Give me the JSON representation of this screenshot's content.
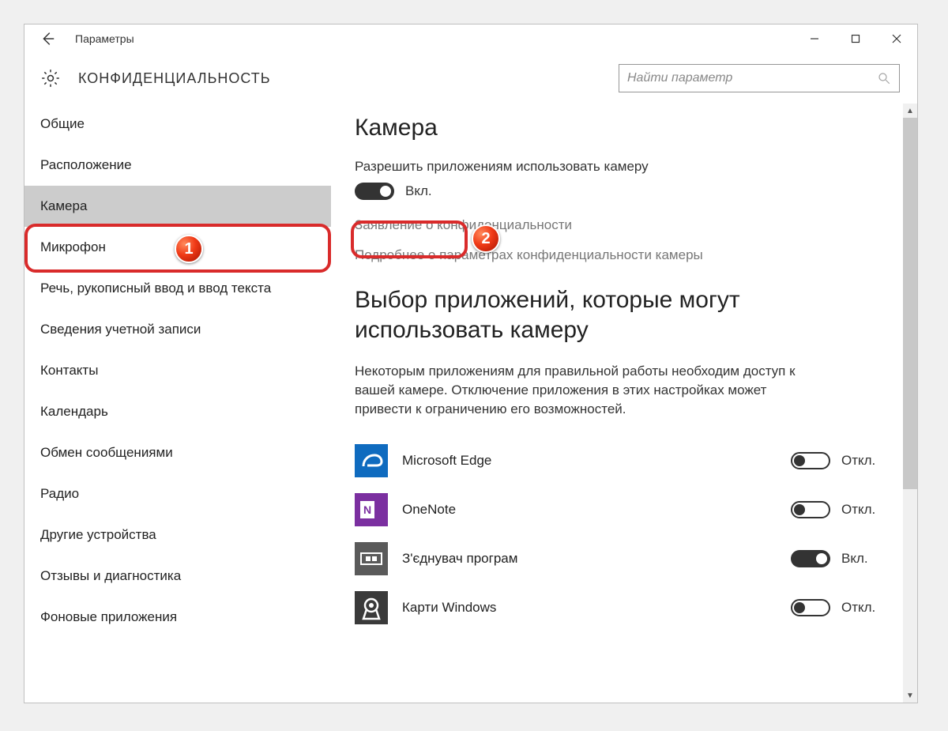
{
  "titlebar": {
    "app_title": "Параметры"
  },
  "header": {
    "section_title": "КОНФИДЕНЦИАЛЬНОСТЬ",
    "search_placeholder": "Найти параметр"
  },
  "sidebar": {
    "items": [
      {
        "label": "Общие",
        "selected": false
      },
      {
        "label": "Расположение",
        "selected": false
      },
      {
        "label": "Камера",
        "selected": true
      },
      {
        "label": "Микрофон",
        "selected": false
      },
      {
        "label": "Речь, рукописный ввод и ввод текста",
        "selected": false
      },
      {
        "label": "Сведения учетной записи",
        "selected": false
      },
      {
        "label": "Контакты",
        "selected": false
      },
      {
        "label": "Календарь",
        "selected": false
      },
      {
        "label": "Обмен сообщениями",
        "selected": false
      },
      {
        "label": "Радио",
        "selected": false
      },
      {
        "label": "Другие устройства",
        "selected": false
      },
      {
        "label": "Отзывы и диагностика",
        "selected": false
      },
      {
        "label": "Фоновые приложения",
        "selected": false
      }
    ]
  },
  "content": {
    "page_title": "Камера",
    "allow_label": "Разрешить приложениям использовать камеру",
    "main_toggle": {
      "on": true,
      "text": "Вкл."
    },
    "link_privacy": "Заявление о конфиденциальности",
    "link_more": "Подробнее о параметрах конфиденциальности камеры",
    "subsection_title": "Выбор приложений, которые могут использовать камеру",
    "description": "Некоторым приложениям для правильной работы необходим доступ к вашей камере. Отключение приложения в этих настройках может привести к ограничению его возможностей.",
    "apps": [
      {
        "name": "Microsoft Edge",
        "on": false,
        "text": "Откл.",
        "icon": "edge"
      },
      {
        "name": "OneNote",
        "on": false,
        "text": "Откл.",
        "icon": "onenote"
      },
      {
        "name": "З'єднувач програм",
        "on": true,
        "text": "Вкл.",
        "icon": "connector"
      },
      {
        "name": "Карти Windows",
        "on": false,
        "text": "Откл.",
        "icon": "maps"
      }
    ]
  },
  "annotations": {
    "badge1": "1",
    "badge2": "2"
  }
}
